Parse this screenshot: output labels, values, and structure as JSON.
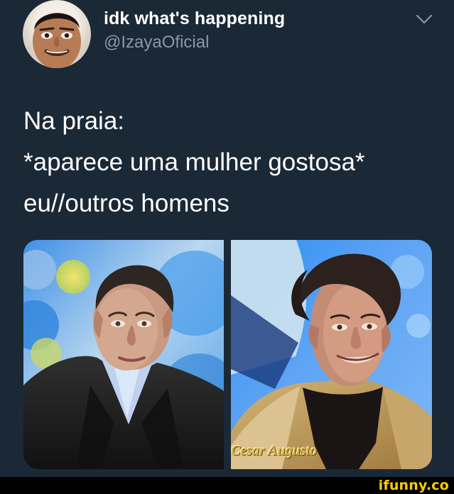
{
  "tweet": {
    "display_name": "idk what's happening",
    "handle": "@IzayaOficial",
    "text_lines": [
      "Na praia:",
      "*aparece uma mulher gostosa*",
      "eu//outros homens"
    ],
    "media": {
      "caption": "Cesar Augusto"
    }
  },
  "watermark": {
    "text": "ifunny.co"
  },
  "colors": {
    "background": "#1b2836",
    "handle": "#8899a6",
    "watermark": "#ffcc00"
  },
  "icons": {
    "menu": "chevron-down-icon"
  }
}
